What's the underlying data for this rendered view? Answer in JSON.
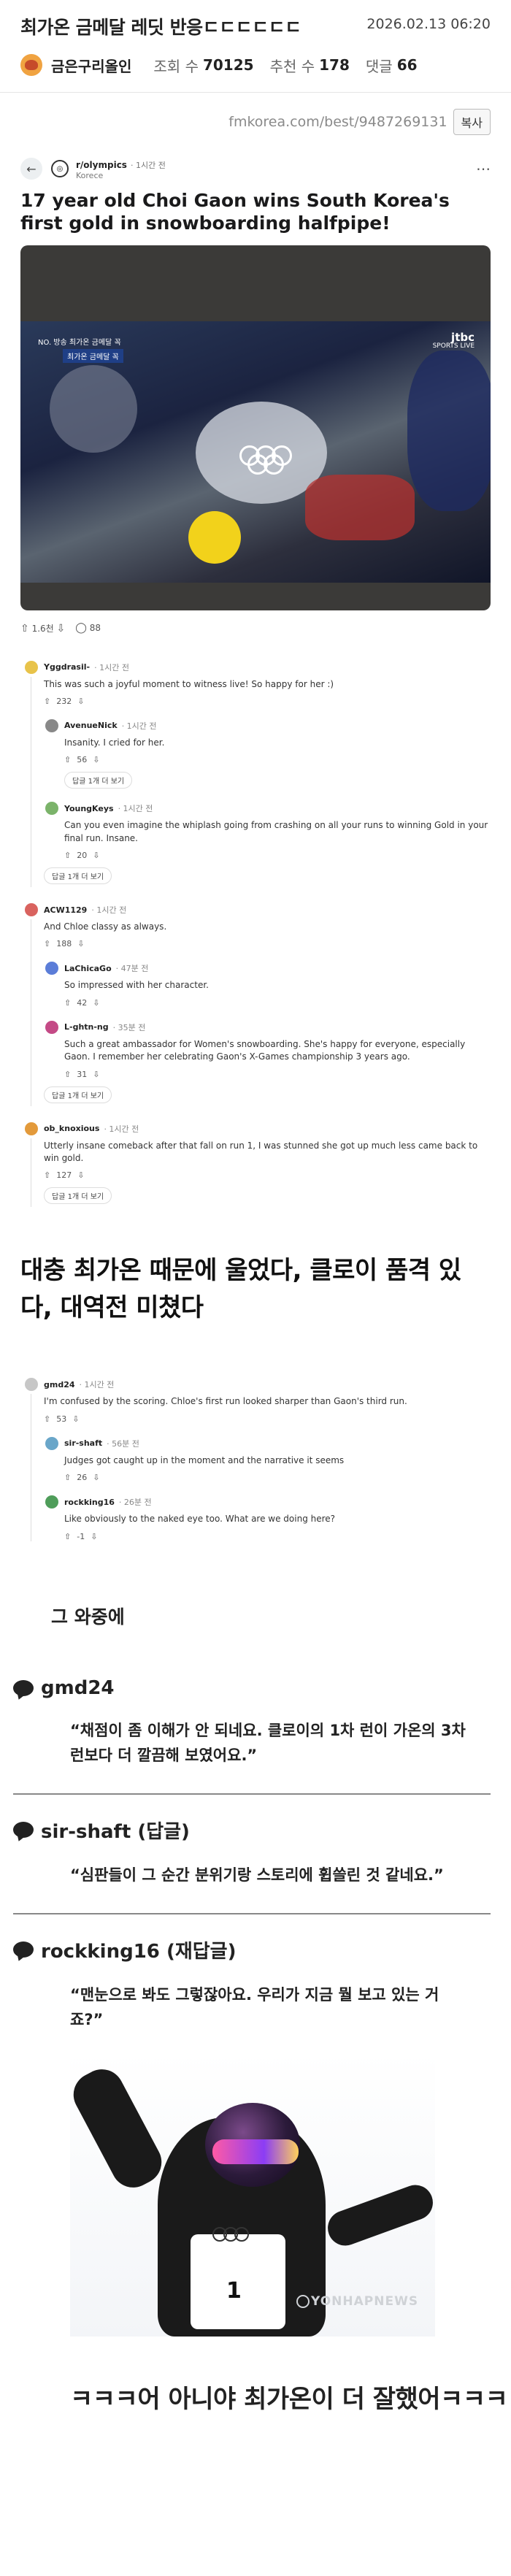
{
  "post": {
    "title": "최가온 금메달 레딧 반응ㄷㄷㄷㄷㄷㄷ",
    "date": "2026.02.13 06:20",
    "author": "금은구리올인",
    "views_label": "조회 수",
    "views": "70125",
    "recommend_label": "추천 수",
    "recommend": "178",
    "comments_label": "댓글",
    "comments": "66",
    "url": "fmkorea.com/best/9487269131",
    "copy_label": "복사"
  },
  "reddit_post": {
    "subreddit": "r/olympics",
    "time": "· 1시간 전",
    "location": "Korece",
    "title": "17 year old Choi Gaon wins South Korea's first gold in snowboarding halfpipe!",
    "video_overlay_left": "NO. 방송 최가온 금메달 꼭",
    "video_banner": "최가온 금메달 꼭",
    "video_overlay_right": "jtbc",
    "video_overlay_right_sub": "SPORTS LIVE",
    "upvotes": "1.6천",
    "comment_count": "88"
  },
  "comments": [
    {
      "user": "Yggdrasil-",
      "time": "· 1시간 전",
      "body": "This was such a joyful moment to witness live! So happy for her :)",
      "votes": "232",
      "avatar_color": "#e8c34a"
    },
    {
      "user": "AvenueNick",
      "time": "· 1시간 전",
      "body": "Insanity. I cried for her.",
      "votes": "56",
      "avatar_color": "#888888"
    },
    {
      "user": "YoungKeys",
      "time": "· 1시간 전",
      "body": "Can you even imagine the whiplash going from crashing on all your runs to winning Gold in your final run. Insane.",
      "votes": "20",
      "avatar_color": "#7bb36a"
    },
    {
      "user": "ACW1129",
      "time": "· 1시간 전",
      "body": "And Chloe classy as always.",
      "votes": "188",
      "avatar_color": "#d9635f"
    },
    {
      "user": "LaChicaGo",
      "time": "· 47분 전",
      "body": "So impressed with her character.",
      "votes": "42",
      "avatar_color": "#5b7dd8"
    },
    {
      "user": "L-ghtn-ng",
      "time": "· 35분 전",
      "body": "Such a great ambassador for Women's snowboarding. She's happy for everyone, especially Gaon. I remember her celebrating Gaon's X-Games championship 3 years ago.",
      "votes": "31",
      "avatar_color": "#c44a86"
    },
    {
      "user": "ob_knoxious",
      "time": "· 1시간 전",
      "body": "Utterly insane comeback after that fall on run 1, I was stunned she got up much less came back to win gold.",
      "votes": "127",
      "avatar_color": "#e39a3b"
    }
  ],
  "more_replies_1": "답글 1개 더 보기",
  "more_replies_2": "답글 1개 더 보기",
  "more_replies_3": "답글 1개 더 보기",
  "more_replies_4": "답글 1개 더 보기",
  "caption_1": "대충 최가온 때문에 울었다, 클로이 품격 있다, 대역전 미쳤다",
  "comments_b": [
    {
      "user": "gmd24",
      "time": "· 1시간 전",
      "body": "I'm confused by the scoring. Chloe's first run looked sharper than Gaon's third run.",
      "votes": "53",
      "avatar_color": "#c7c7c7"
    },
    {
      "user": "sir-shaft",
      "time": "· 56분 전",
      "body": "Judges got caught up in the moment and the narrative it seems",
      "votes": "26",
      "avatar_color": "#6aa6c9"
    },
    {
      "user": "rockking16",
      "time": "· 26분 전",
      "body": "Like obviously to the naked eye too. What are we doing here?",
      "votes": "-1",
      "avatar_color": "#4f9d5a"
    }
  ],
  "sub_heading": "그 와중에",
  "translations": [
    {
      "head": "gmd24",
      "quote": "“채점이 좀 이해가 안 되네요. 클로이의 1차 런이 가온의 3차 런보다 더 깔끔해 보였어요.”"
    },
    {
      "head": "sir-shaft (답글)",
      "quote": "“심판들이 그 순간 분위기랑 스토리에 휩쓸린 것 같네요.”"
    },
    {
      "head": "rockking16 (재답글)",
      "quote": "“맨눈으로 봐도 그렇잖아요. 우리가 지금 뭘 보고 있는 거죠?”"
    }
  ],
  "photo": {
    "bib": "1",
    "watermark": "YONHAPNEWS"
  },
  "final_caption": "ㅋㅋㅋ어 아니야 최가온이 더 잘했어ㅋㅋㅋ"
}
